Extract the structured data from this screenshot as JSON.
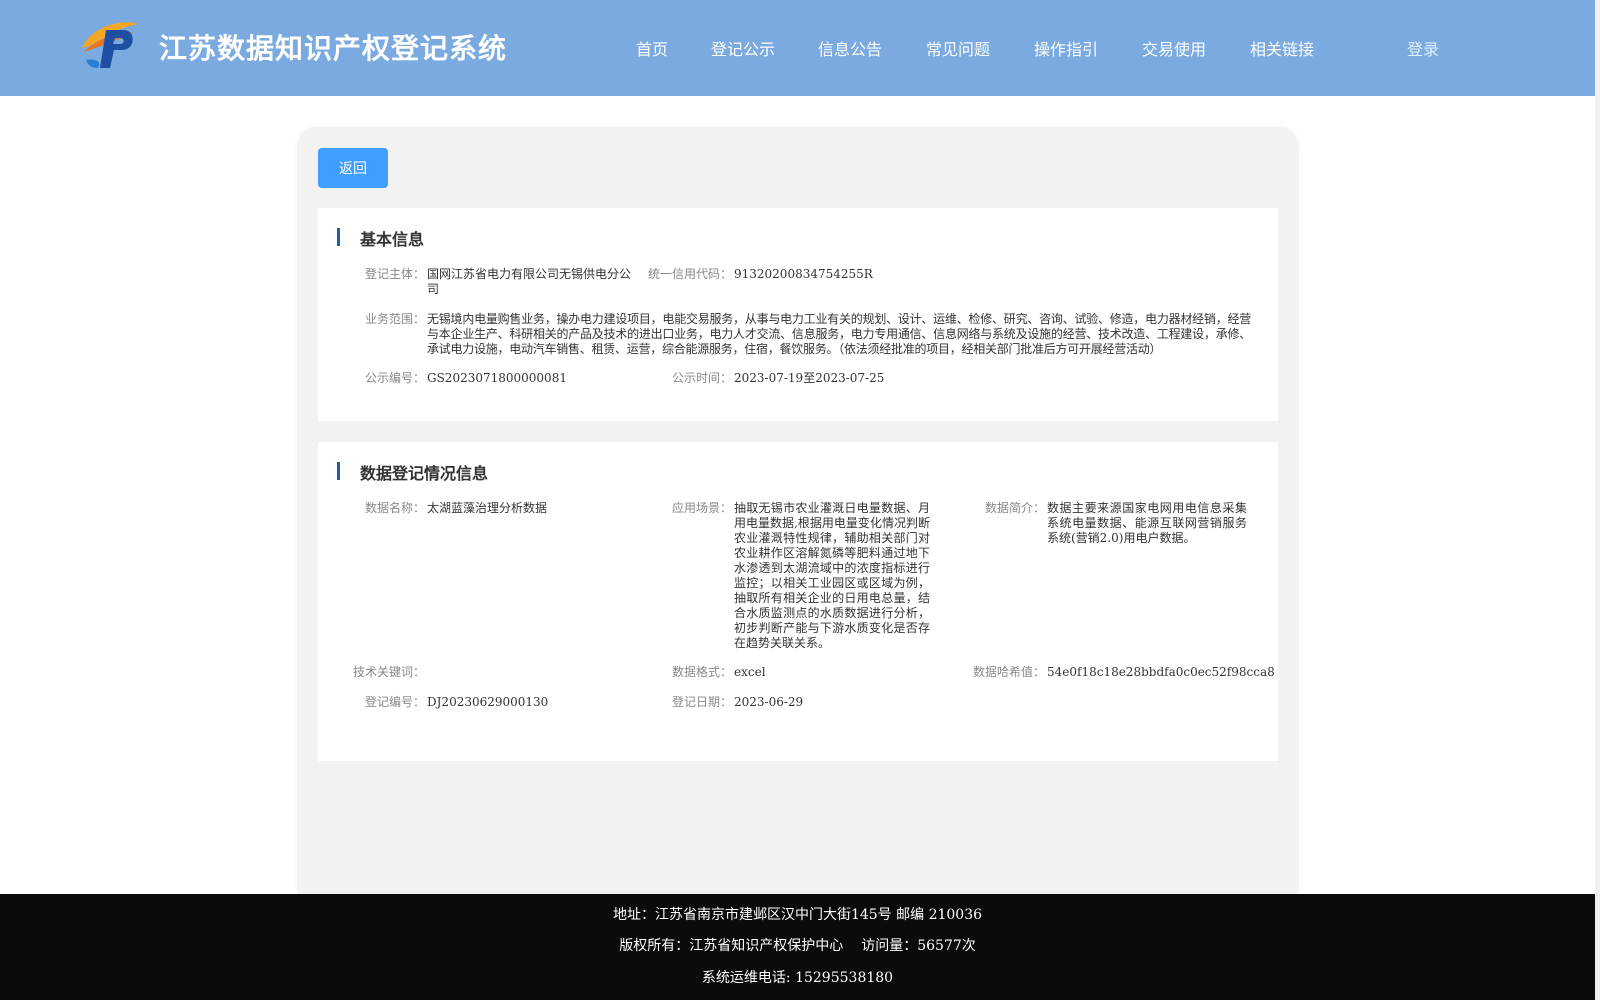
{
  "header": {
    "site_title": "江苏数据知识产权登记系统",
    "nav": [
      "首页",
      "登记公示",
      "信息公告",
      "常见问题",
      "操作指引",
      "交易使用",
      "相关链接"
    ],
    "login_label": "登录"
  },
  "back_label": "返回",
  "basic_info": {
    "title": "基本信息",
    "subject_label": "登记主体：",
    "subject_value": "国网江苏省电力有限公司无锡供电分公司",
    "credit_code_label": "统一信用代码：",
    "credit_code_value": "91320200834754255R",
    "scope_label": "业务范围：",
    "scope_value": "无锡境内电量购售业务，操办电力建设项目，电能交易服务，从事与电力工业有关的规划、设计、运维、检修、研究、咨询、试验、修造，电力器材经销，经营与本企业生产、科研相关的产品及技术的进出口业务，电力人才交流、信息服务，电力专用通信、信息网络与系统及设施的经营、技术改造、工程建设，承修、承试电力设施，电动汽车销售、租赁、运营，综合能源服务，住宿，餐饮服务。（依法须经批准的项目，经相关部门批准后方可开展经营活动）",
    "notice_no_label": "公示编号：",
    "notice_no_value": "GS2023071800000081",
    "notice_time_label": "公示时间：",
    "notice_time_value": "2023-07-19至2023-07-25"
  },
  "data_info": {
    "title": "数据登记情况信息",
    "name_label": "数据名称：",
    "name_value": "太湖蓝藻治理分析数据",
    "scenario_label": "应用场景：",
    "scenario_value": "抽取无锡市农业灌溉日电量数据、月用电量数据,根据用电量变化情况判断农业灌溉特性规律，辅助相关部门对农业耕作区溶解氮磷等肥料通过地下水渗透到太湖流域中的浓度指标进行监控；以相关工业园区或区域为例，抽取所有相关企业的日用电总量，结合水质监测点的水质数据进行分析，初步判断产能与下游水质变化是否存在趋势关联关系。",
    "intro_label": "数据简介：",
    "intro_value": "数据主要来源国家电网用电信息采集系统电量数据、能源互联网营销服务系统(营销2.0)用电户数据。",
    "keywords_label": "技术关键词：",
    "keywords_value": "",
    "format_label": "数据格式：",
    "format_value": "excel",
    "hash_label": "数据哈希值：",
    "hash_value": "54e0f18c18e28bbdfa0c0ec52f98cca8",
    "reg_no_label": "登记编号：",
    "reg_no_value": "DJ20230629000130",
    "reg_date_label": "登记日期：",
    "reg_date_value": "2023-06-29"
  },
  "footer": {
    "address": "地址：江苏省南京市建邺区汉中门大街145号 邮编 210036",
    "copyright": "版权所有：江苏省知识产权保护中心",
    "visits": "访问量：56577次",
    "phone": "系统运维电话: 15295538180"
  }
}
